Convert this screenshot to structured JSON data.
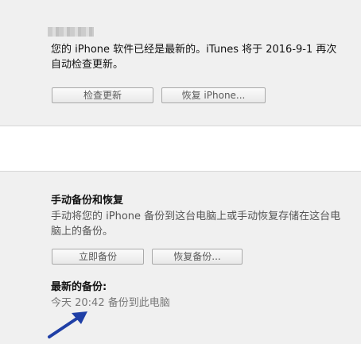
{
  "software": {
    "status_text": "您的 iPhone 软件已经是最新的。iTunes 将于 2016-9-1 再次自动检查更新。",
    "check_update_label": "检查更新",
    "restore_label": "恢复 iPhone..."
  },
  "backup": {
    "title": "手动备份和恢复",
    "description": "手动将您的 iPhone 备份到这台电脑上或手动恢复存储在这台电脑上的备份。",
    "backup_now_label": "立即备份",
    "restore_backup_label": "恢复备份...",
    "latest_title": "最新的备份:",
    "latest_value": "今天 20:42 备份到此电脑"
  },
  "colors": {
    "arrow": "#1f3fa6"
  },
  "icons": [
    "arrow-annotation-icon"
  ]
}
